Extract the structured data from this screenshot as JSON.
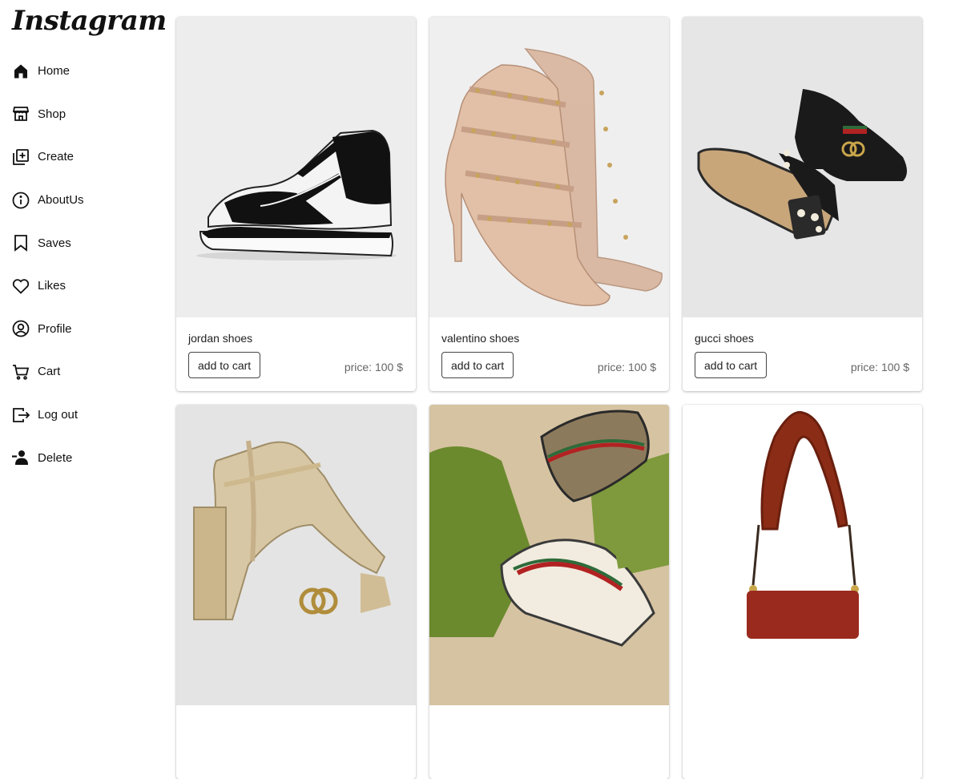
{
  "app": {
    "logo": "Instagram"
  },
  "sidebar": {
    "items": [
      {
        "label": "Home",
        "icon": "home-icon"
      },
      {
        "label": "Shop",
        "icon": "shop-icon"
      },
      {
        "label": "Create",
        "icon": "create-icon"
      },
      {
        "label": "AboutUs",
        "icon": "info-icon"
      },
      {
        "label": "Saves",
        "icon": "bookmark-icon"
      },
      {
        "label": "Likes",
        "icon": "heart-icon"
      },
      {
        "label": "Profile",
        "icon": "profile-icon"
      },
      {
        "label": "Cart",
        "icon": "cart-icon"
      },
      {
        "label": "Log out",
        "icon": "logout-icon"
      },
      {
        "label": "Delete",
        "icon": "delete-user-icon"
      }
    ]
  },
  "products": [
    {
      "title": "jordan shoes",
      "button": "add to cart",
      "price": "price: 100 $",
      "image": "sneaker-image"
    },
    {
      "title": "valentino shoes",
      "button": "add to cart",
      "price": "price: 100 $",
      "image": "heels-image"
    },
    {
      "title": "gucci shoes",
      "button": "add to cart",
      "price": "price: 100 $",
      "image": "loafers-image"
    },
    {
      "title": "",
      "button": "",
      "price": "",
      "image": "gold-heels-image"
    },
    {
      "title": "",
      "button": "",
      "price": "",
      "image": "gucci-sneakers-box-image"
    },
    {
      "title": "",
      "button": "",
      "price": "",
      "image": "fur-strap-bag-image"
    }
  ]
}
